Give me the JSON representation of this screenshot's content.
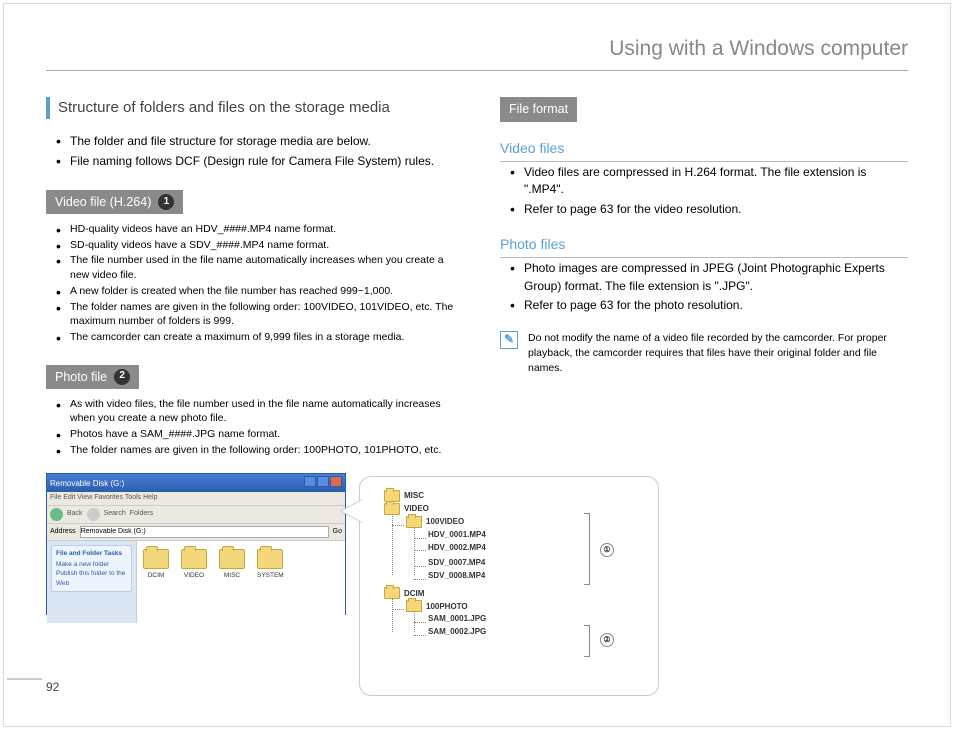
{
  "page": {
    "title": "Using with a Windows computer",
    "number": "92"
  },
  "left": {
    "heading": "Structure of folders and files on the storage media",
    "intro": [
      "The folder and file structure for storage media are below.",
      "File naming follows DCF (Design rule for Camera File System) rules."
    ],
    "videoTag": "Video file (H.264)",
    "videoNum": "1",
    "videoItems": [
      "HD-quality videos have an HDV_####.MP4 name format.",
      "SD-quality videos have a SDV_####.MP4 name format.",
      "The file number used in the file name automatically increases when you create a new video file.",
      "A new folder is created when the file number has reached 999~1,000.",
      "The folder names are given in the following order: 100VIDEO, 101VIDEO, etc. The maximum number of folders  is 999.",
      "The camcorder can create a maximum of 9,999 files in a storage media."
    ],
    "photoTag": "Photo file",
    "photoNum": "2",
    "photoItems": [
      "As with video files, the file number used in the file name automatically increases when you create a new photo file.",
      "Photos have a SAM_####.JPG name format.",
      "The folder names are given in the following order: 100PHOTO, 101PHOTO, etc."
    ]
  },
  "right": {
    "fileFormatTag": "File format",
    "videoHeading": "Video files",
    "videoItems": [
      "Video files are compressed in H.264 format. The file extension is \".MP4\".",
      "Refer to page 63 for the video resolution."
    ],
    "photoHeading": "Photo files",
    "photoItems": [
      "Photo images are compressed in JPEG (Joint Photographic Experts Group) format. The file extension is \".JPG\".",
      "Refer to page 63 for the photo resolution."
    ],
    "note": "Do not modify the name of a video file recorded by the camcorder. For proper playback, the camcorder requires that files have their original folder and file names."
  },
  "explorer": {
    "title": "Removable Disk (G:)",
    "menu": "File   Edit   View   Favorites   Tools   Help",
    "back": "Back",
    "search": "Search",
    "foldersBtn": "Folders",
    "address": "Address",
    "go": "Go",
    "taskHeader": "File and Folder Tasks",
    "task1": "Make a new folder",
    "task2": "Publish this folder to the Web",
    "folders": [
      "DCIM",
      "VIDEO",
      "MISC",
      "SYSTEM"
    ]
  },
  "tree": {
    "misc": "MISC",
    "video": "VIDEO",
    "videoSub": "100VIDEO",
    "vfiles": [
      "HDV_0001.MP4",
      "HDV_0002.MP4",
      "SDV_0007.MP4",
      "SDV_0008.MP4"
    ],
    "dcim": "DCIM",
    "dcimSub": "100PHOTO",
    "pfiles": [
      "SAM_0001.JPG",
      "SAM_0002.JPG"
    ],
    "label1": "①",
    "label2": "②"
  }
}
